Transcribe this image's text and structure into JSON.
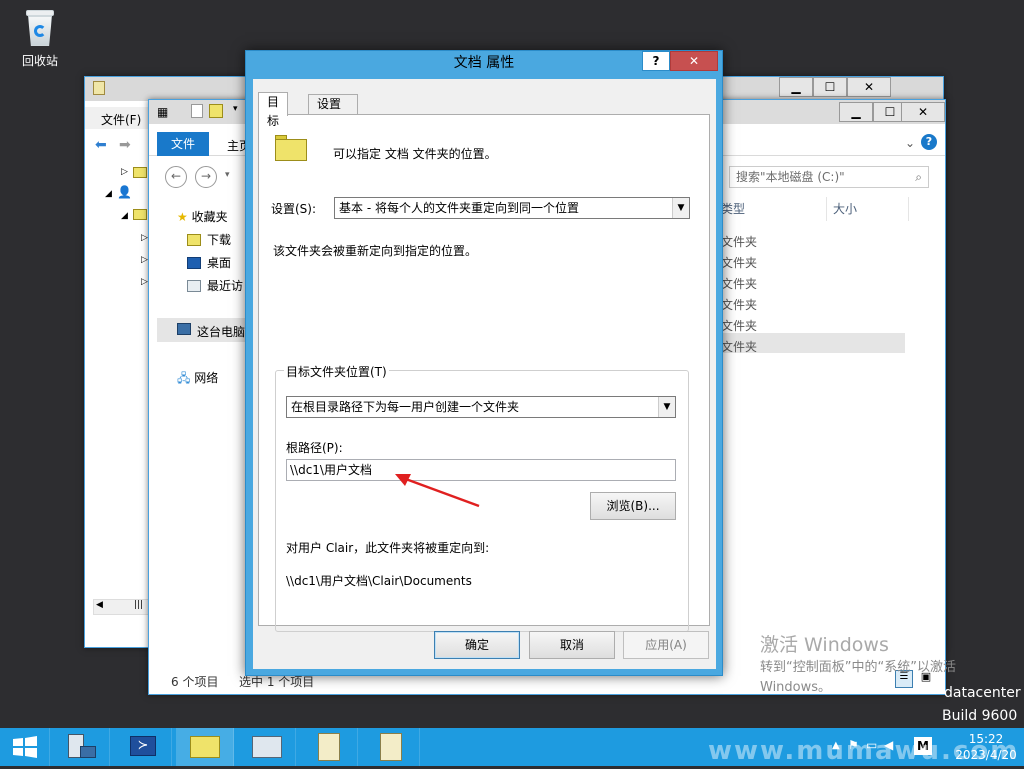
{
  "desktop": {
    "recycle_bin_label": "回收站",
    "activation": {
      "title": "激活 Windows",
      "line1": "转到“控制面板”中的“系统”以激活",
      "line2": "Windows。"
    },
    "os_build": {
      "line1": "datacenter",
      "line2": "Build 9600"
    },
    "site_watermark": "www.mumawu.com"
  },
  "explorer_back": {
    "menu_file": "文件(F)"
  },
  "explorer_front": {
    "tab_file": "文件",
    "tab_home": "主页",
    "search_placeholder": "搜索\"本地磁盘 (C:)\"",
    "nav": {
      "favorites": "收藏夹",
      "downloads": "下载",
      "desktop": "桌面",
      "recent": "最近访",
      "this_pc": "这台电脑",
      "network": "网络"
    },
    "columns": {
      "type": "类型",
      "size": "大小"
    },
    "rows": [
      "文件夹",
      "文件夹",
      "文件夹",
      "文件夹",
      "文件夹",
      "文件夹"
    ],
    "status_count": "6 个项目",
    "status_selected": "选中 1 个项目"
  },
  "dialog": {
    "title": "文档 属性",
    "help_label": "?",
    "close_label": "✕",
    "tabs": [
      "目标",
      "设置"
    ],
    "intro_text": "可以指定 文档 文件夹的位置。",
    "setting_label": "设置(S):",
    "setting_value": "基本 - 将每个人的文件夹重定向到同一个位置",
    "setting_desc": "该文件夹会被重新定向到指定的位置。",
    "group_title": "目标文件夹位置(T)",
    "target_value": "在根目录路径下为每一用户创建一个文件夹",
    "root_path_label": "根路径(P):",
    "root_path_value": "\\\\dc1\\用户文档",
    "browse_button": "浏览(B)...",
    "redirect_text": "对用户 Clair，此文件夹将被重定向到:",
    "redirect_path": "\\\\dc1\\用户文档\\Clair\\Documents",
    "ok_button": "确定",
    "cancel_button": "取消",
    "apply_button": "应用(A)"
  },
  "taskbar": {
    "time": "15:22",
    "date": "2023/4/20"
  },
  "colors": {
    "accent": "#1979ca",
    "taskbar": "#1e9be0",
    "annotation_arrow": "#e02020"
  }
}
